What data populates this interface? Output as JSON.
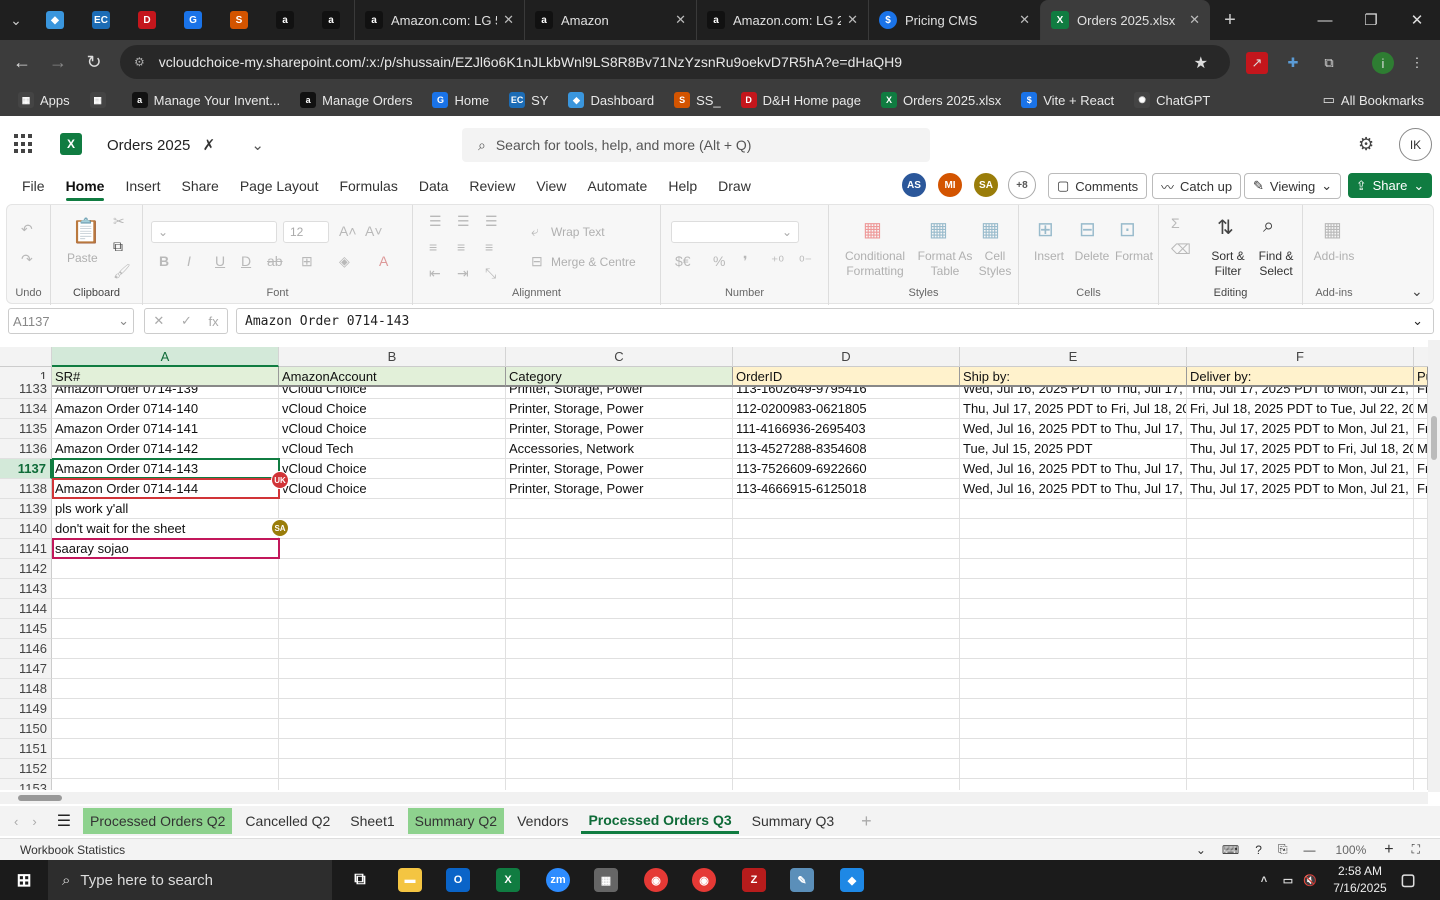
{
  "browser": {
    "tabs": [
      {
        "title": "Amazon.com: LG 5",
        "favicon": "amazon-icon",
        "color": "#111111"
      },
      {
        "title": "Amazon",
        "favicon": "amazon-icon",
        "color": "#111111"
      },
      {
        "title": "Amazon.com: LG 2",
        "favicon": "amazon-icon",
        "color": "#111111"
      },
      {
        "title": "Pricing CMS",
        "favicon": "dollar-icon",
        "color": "#1a73e8"
      },
      {
        "title": "Orders 2025.xlsx",
        "favicon": "excel-icon",
        "color": "#107c41"
      }
    ],
    "pinned": [
      {
        "name": "sharepoint-icon",
        "glyph": "◆",
        "color": "#3a96dd"
      },
      {
        "name": "ec-icon",
        "glyph": "EC",
        "color": "#1c6cb5"
      },
      {
        "name": "dh-icon",
        "glyph": "D",
        "color": "#c4161c"
      },
      {
        "name": "g-icon",
        "glyph": "G",
        "color": "#1a73e8"
      },
      {
        "name": "ss-icon",
        "glyph": "S",
        "color": "#d35400"
      },
      {
        "name": "amazon-icon",
        "glyph": "a",
        "color": "#111"
      },
      {
        "name": "amazon-icon",
        "glyph": "a",
        "color": "#111"
      }
    ],
    "url": "vcloudchoice-my.sharepoint.com/:x:/p/shussain/EZJl6o6K1nJLkbWnl9LS8R8Bv71NzYzsnRu9oekvD7R5hA?e=dHaQH9",
    "bookmarks": [
      {
        "label": "Apps",
        "icon": "apps-icon",
        "glyph": "▦",
        "color": "#444"
      },
      {
        "label": "",
        "icon": "grid-icon",
        "glyph": "▦",
        "color": "#444"
      },
      {
        "label": "Manage Your Invent...",
        "icon": "amazon-icon",
        "glyph": "a",
        "color": "#111"
      },
      {
        "label": "Manage Orders",
        "icon": "amazon-icon",
        "glyph": "a",
        "color": "#111"
      },
      {
        "label": "Home",
        "icon": "g-icon",
        "glyph": "G",
        "color": "#1a73e8"
      },
      {
        "label": "SY",
        "icon": "ec-icon",
        "glyph": "EC",
        "color": "#1c6cb5"
      },
      {
        "label": "Dashboard",
        "icon": "sharepoint-icon",
        "glyph": "◆",
        "color": "#3a96dd"
      },
      {
        "label": "SS_",
        "icon": "ss-icon",
        "glyph": "S",
        "color": "#d35400"
      },
      {
        "label": "D&H Home page",
        "icon": "dh-icon",
        "glyph": "D",
        "color": "#c4161c"
      },
      {
        "label": "Orders 2025.xlsx",
        "icon": "excel-icon",
        "glyph": "X",
        "color": "#107c41"
      },
      {
        "label": "Vite + React",
        "icon": "dollar-icon",
        "glyph": "$",
        "color": "#1a73e8"
      },
      {
        "label": "ChatGPT",
        "icon": "chatgpt-icon",
        "glyph": "✺",
        "color": "#444"
      }
    ],
    "all_bookmarks": "All Bookmarks"
  },
  "excel": {
    "doc_title": "Orders 2025",
    "search_placeholder": "Search for tools, help, and more (Alt + Q)",
    "account_initials": "IK",
    "menu": [
      "File",
      "Home",
      "Insert",
      "Share",
      "Page Layout",
      "Formulas",
      "Data",
      "Review",
      "View",
      "Automate",
      "Help",
      "Draw"
    ],
    "active_menu": "Home",
    "collaborators": [
      {
        "initials": "AS",
        "color": "#2b579a"
      },
      {
        "initials": "MI",
        "color": "#d35400"
      },
      {
        "initials": "SA",
        "color": "#9a7d0a"
      }
    ],
    "more_collaborators": "+8",
    "comments_label": "Comments",
    "catchup_label": "Catch up",
    "viewing_label": "Viewing",
    "share_label": "Share",
    "ribbon": {
      "undo_label": "Undo",
      "paste_label": "Paste",
      "clipboard_label": "Clipboard",
      "font_size": "12",
      "font_label": "Font",
      "wrap_text": "Wrap Text",
      "merge_centre": "Merge & Centre",
      "alignment_label": "Alignment",
      "number_label": "Number",
      "conditional_formatting": "Conditional Formatting",
      "format_as_table": "Format As Table",
      "cell_styles": "Cell Styles",
      "styles_label": "Styles",
      "insert": "Insert",
      "delete": "Delete",
      "format": "Format",
      "cells_label": "Cells",
      "sort_filter": "Sort & Filter",
      "find_select": "Find & Select",
      "editing_label": "Editing",
      "addins": "Add-ins",
      "addins_label": "Add-ins"
    },
    "name_box": "A1137",
    "formula_value": "Amazon Order 0714-143",
    "columns": [
      "A",
      "B",
      "C",
      "D",
      "E",
      "F"
    ],
    "header_row": {
      "num": "1",
      "cells": [
        "SR#",
        "AmazonAccount",
        "Category",
        "OrderID",
        "Ship by:",
        "Deliver by:",
        "Pu"
      ]
    },
    "rows": [
      {
        "num": "1133",
        "cells": [
          "Amazon Order 0714-139",
          "vCloud Choice",
          "Printer, Storage, Power",
          "113-1602649-9795416",
          "Wed, Jul 16, 2025 PDT to Thu, Jul 17, 2",
          "Thu, Jul 17, 2025 PDT to Mon, Jul 21, 2",
          "Fr"
        ]
      },
      {
        "num": "1134",
        "cells": [
          "Amazon Order 0714-140",
          "vCloud Choice",
          "Printer, Storage, Power",
          "112-0200983-0621805",
          "Thu, Jul 17, 2025 PDT to Fri, Jul 18, 20",
          "Fri, Jul 18, 2025 PDT to Tue, Jul 22, 20",
          "M"
        ]
      },
      {
        "num": "1135",
        "cells": [
          "Amazon Order 0714-141",
          "vCloud Choice",
          "Printer, Storage, Power",
          "111-4166936-2695403",
          "Wed, Jul 16, 2025 PDT to Thu, Jul 17, 2",
          "Thu, Jul 17, 2025 PDT to Mon, Jul 21, 2",
          "Fr"
        ]
      },
      {
        "num": "1136",
        "cells": [
          "Amazon Order 0714-142",
          "vCloud Tech",
          "Accessories, Network",
          "113-4527288-8354608",
          "Tue, Jul 15, 2025 PDT",
          "Thu, Jul 17, 2025 PDT to Fri, Jul 18, 20",
          "M"
        ]
      },
      {
        "num": "1137",
        "cells": [
          "Amazon Order 0714-143",
          "vCloud Choice",
          "Printer, Storage, Power",
          "113-7526609-6922660",
          "Wed, Jul 16, 2025 PDT to Thu, Jul 17, 2",
          "Thu, Jul 17, 2025 PDT to Mon, Jul 21, 2",
          "Fr"
        ]
      },
      {
        "num": "1138",
        "cells": [
          "Amazon Order 0714-144",
          "vCloud Choice",
          "Printer, Storage, Power",
          "113-4666915-6125018",
          "Wed, Jul 16, 2025 PDT to Thu, Jul 17, 2",
          "Thu, Jul 17, 2025 PDT to Mon, Jul 21, 2",
          "Fr"
        ]
      },
      {
        "num": "1139",
        "cells": [
          "pls work y'all",
          "",
          "",
          "",
          "",
          "",
          ""
        ]
      },
      {
        "num": "1140",
        "cells": [
          "don't wait for the sheet",
          "",
          "",
          "",
          "",
          "",
          ""
        ]
      },
      {
        "num": "1141",
        "cells": [
          "saaray sojao",
          "",
          "",
          "",
          "",
          "",
          ""
        ]
      },
      {
        "num": "1142",
        "cells": [
          "",
          "",
          "",
          "",
          "",
          "",
          ""
        ]
      },
      {
        "num": "1143",
        "cells": [
          "",
          "",
          "",
          "",
          "",
          "",
          ""
        ]
      },
      {
        "num": "1144",
        "cells": [
          "",
          "",
          "",
          "",
          "",
          "",
          ""
        ]
      },
      {
        "num": "1145",
        "cells": [
          "",
          "",
          "",
          "",
          "",
          "",
          ""
        ]
      },
      {
        "num": "1146",
        "cells": [
          "",
          "",
          "",
          "",
          "",
          "",
          ""
        ]
      },
      {
        "num": "1147",
        "cells": [
          "",
          "",
          "",
          "",
          "",
          "",
          ""
        ]
      },
      {
        "num": "1148",
        "cells": [
          "",
          "",
          "",
          "",
          "",
          "",
          ""
        ]
      },
      {
        "num": "1149",
        "cells": [
          "",
          "",
          "",
          "",
          "",
          "",
          ""
        ]
      },
      {
        "num": "1150",
        "cells": [
          "",
          "",
          "",
          "",
          "",
          "",
          ""
        ]
      },
      {
        "num": "1151",
        "cells": [
          "",
          "",
          "",
          "",
          "",
          "",
          ""
        ]
      },
      {
        "num": "1152",
        "cells": [
          "",
          "",
          "",
          "",
          "",
          "",
          ""
        ]
      },
      {
        "num": "1153",
        "cells": [
          "",
          "",
          "",
          "",
          "",
          "",
          ""
        ]
      }
    ],
    "selected_row": "1137",
    "presence_markers": [
      {
        "initials": "UK",
        "color": "#d13438"
      },
      {
        "initials": "SA",
        "color": "#9a7d0a"
      }
    ],
    "sheets": [
      {
        "name": "Processed Orders Q2",
        "style": "grn"
      },
      {
        "name": "Cancelled Q2",
        "style": ""
      },
      {
        "name": "Sheet1",
        "style": ""
      },
      {
        "name": "Summary Q2",
        "style": "grn"
      },
      {
        "name": "Vendors",
        "style": ""
      },
      {
        "name": "Processed Orders Q3",
        "style": "act"
      },
      {
        "name": "Summary Q3",
        "style": ""
      }
    ],
    "status_left": "Workbook Statistics",
    "zoom": "100%"
  },
  "taskbar": {
    "search_placeholder": "Type here to search",
    "time": "2:58 AM",
    "date": "7/16/2025"
  }
}
